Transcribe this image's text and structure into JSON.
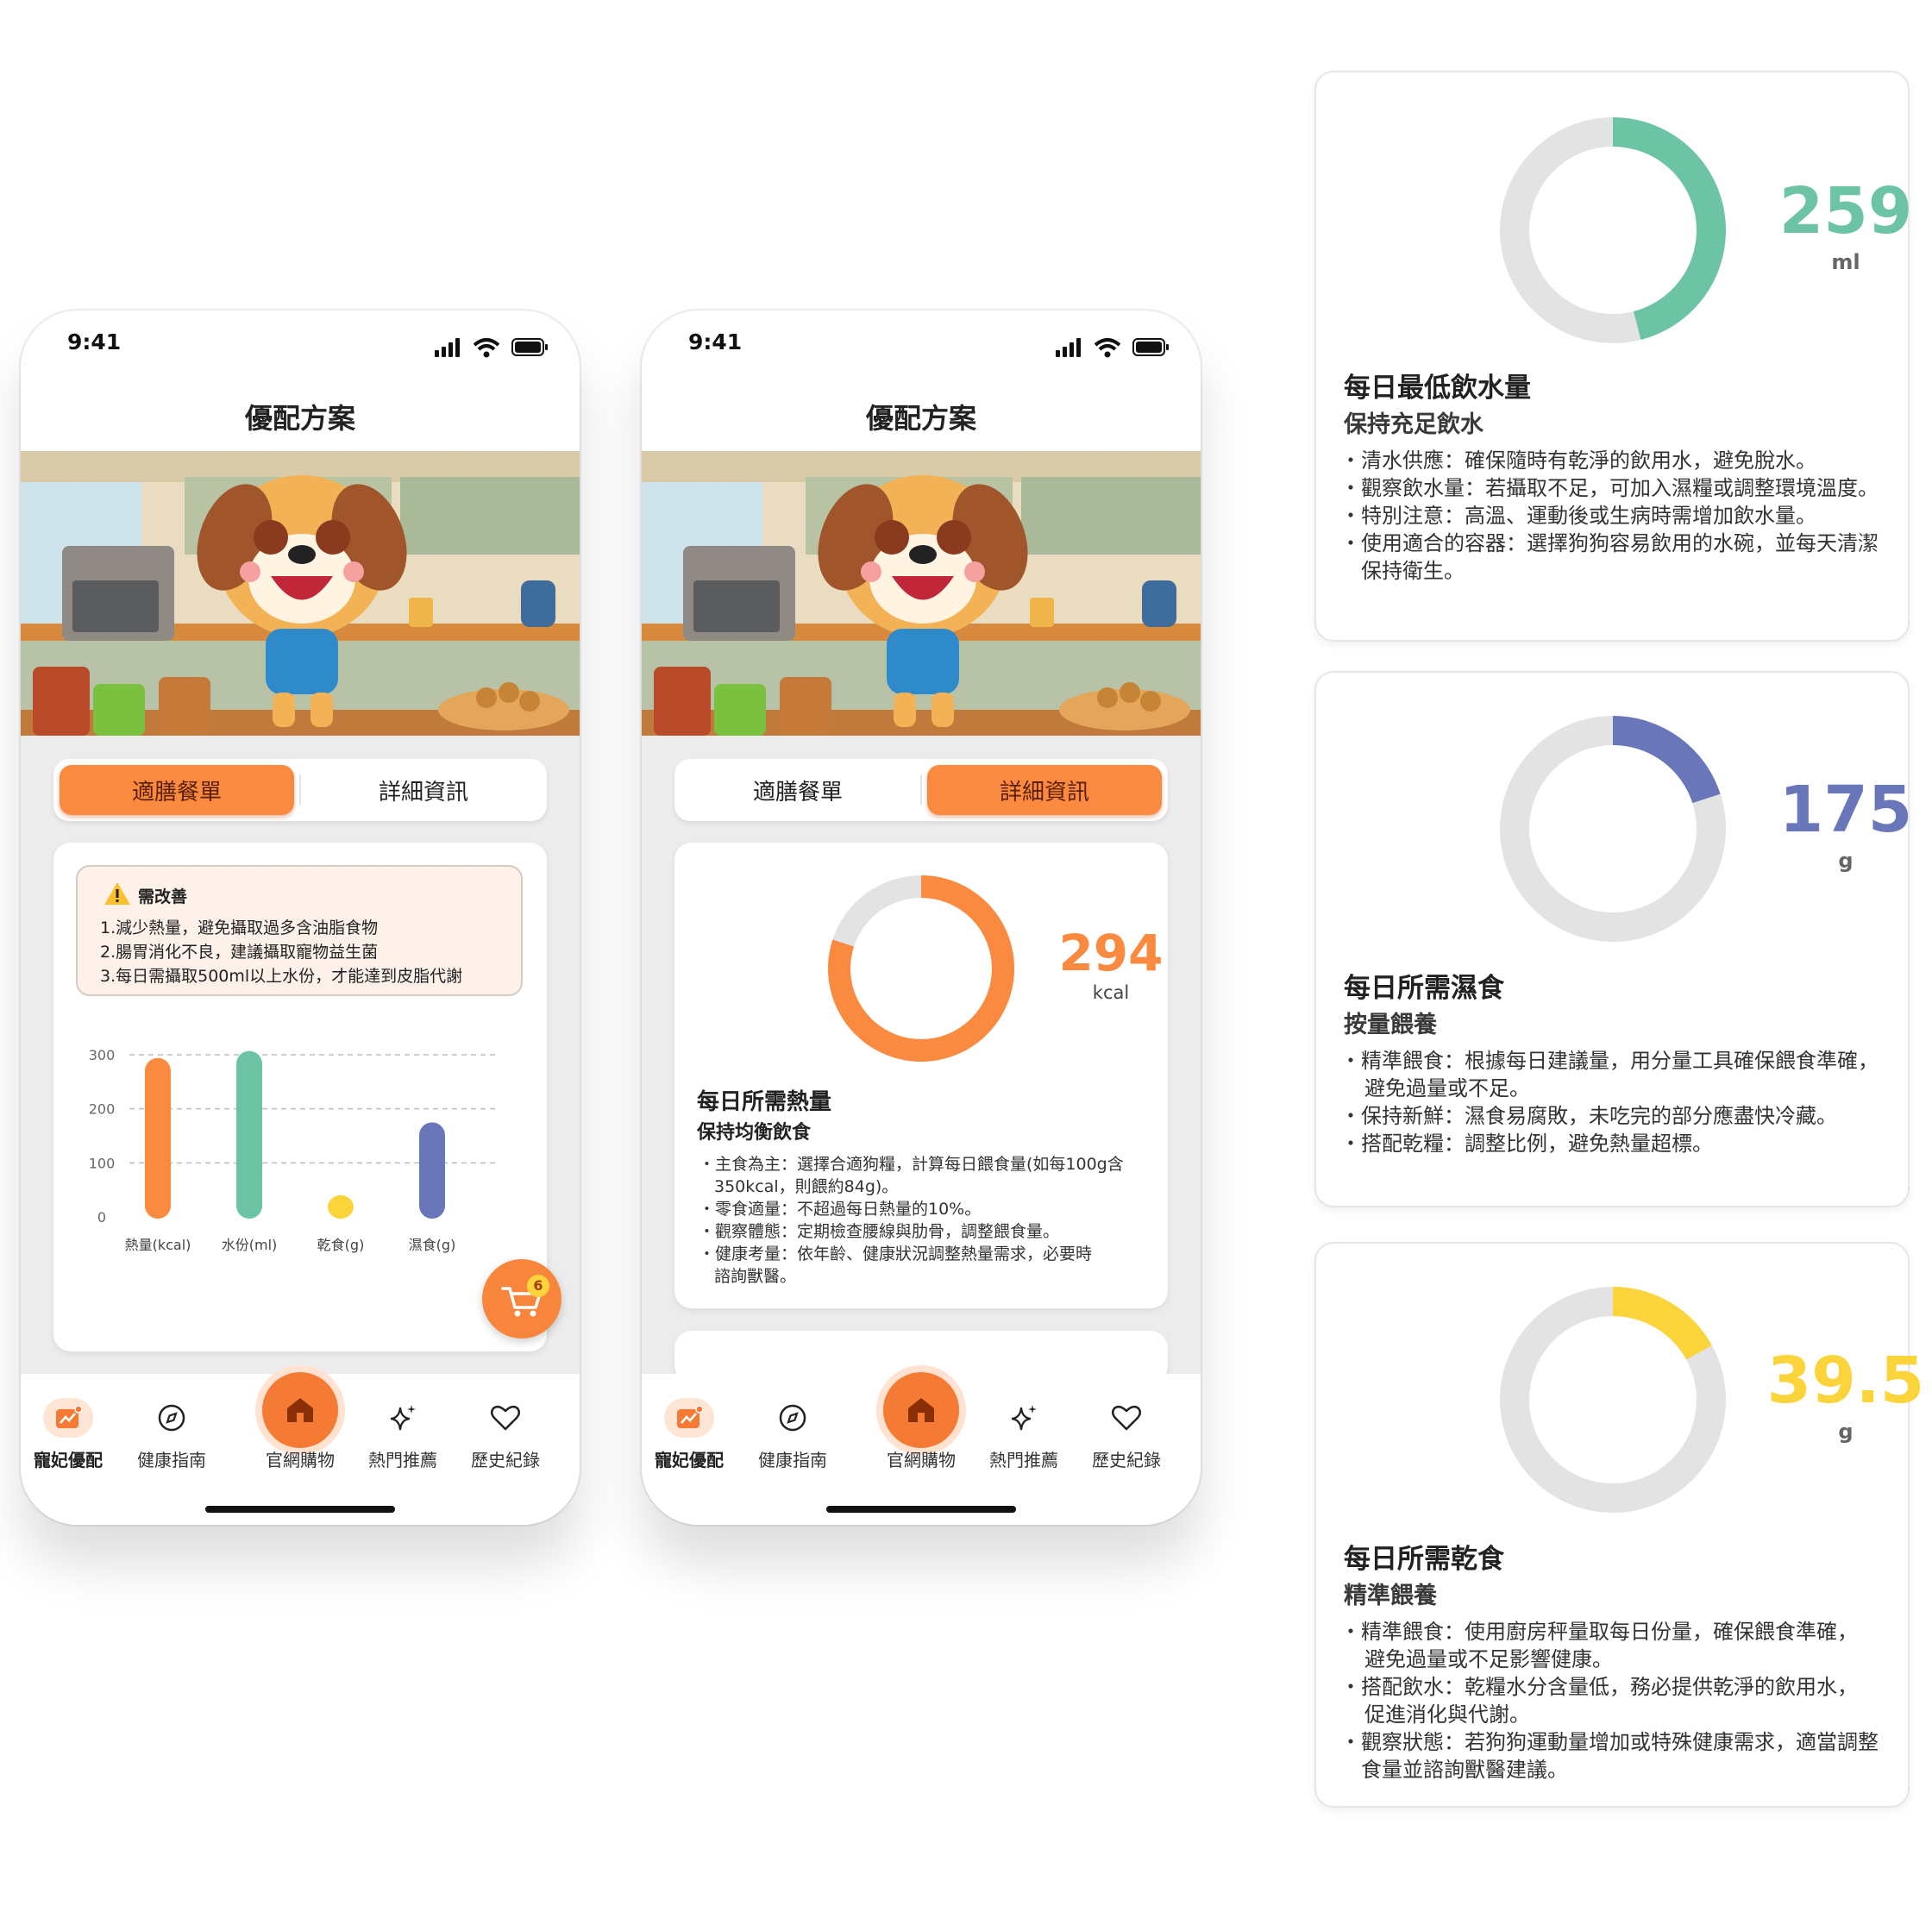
{
  "status": {
    "time": "9:41"
  },
  "app": {
    "title": "優配方案"
  },
  "tabs": {
    "menu": "適膳餐單",
    "details": "詳細資訊"
  },
  "warning": {
    "title": "需改善",
    "lines": [
      "1.減少熱量，避免攝取過多含油脂食物",
      "2.腸胃消化不良，建議攝取寵物益生菌",
      "3.每日需攝取500ml以上水份，才能達到皮脂代謝"
    ]
  },
  "chart_data": {
    "type": "bar",
    "categories": [
      "熱量(kcal)",
      "水份(ml)",
      "乾食(g)",
      "濕食(g)"
    ],
    "values": [
      294,
      307,
      40,
      175
    ],
    "colors": [
      "#fa8a3f",
      "#6cc4a4",
      "#fbd33a",
      "#6977ba"
    ],
    "ylim": [
      0,
      300
    ],
    "yticks": [
      "300",
      "200",
      "100",
      "0"
    ],
    "grid": "dashed"
  },
  "cart": {
    "count": "6"
  },
  "nav": {
    "items": [
      {
        "label": "寵妃優配",
        "icon": "chart-icon"
      },
      {
        "label": "健康指南",
        "icon": "compass-icon"
      },
      {
        "label": "官網購物",
        "icon": "home-icon"
      },
      {
        "label": "熱門推薦",
        "icon": "sparkle-icon"
      },
      {
        "label": "歷史紀錄",
        "icon": "heart-icon"
      }
    ]
  },
  "calories": {
    "value": "294",
    "unit": "kcal",
    "fraction": 0.8,
    "title": "每日所需熱量",
    "subtitle": "保持均衡飲食",
    "lines": [
      "・主食為主：選擇合適狗糧，計算每日餵食量(如每100g含",
      "350kcal，則餵約84g)。",
      "・零食適量：不超過每日熱量的10%。",
      "・觀察體態：定期檢查腰線與肋骨，調整餵食量。",
      "・健康考量：依年齡、健康狀況調整熱量需求，必要時",
      "諮詢獸醫。"
    ],
    "color": "#fa8a3f"
  },
  "water": {
    "value": "259",
    "unit": "ml",
    "fraction": 0.46,
    "title": "每日最低飲水量",
    "subtitle": "保持充足飲水",
    "lines": [
      "・清水供應：確保隨時有乾淨的飲用水，避免脫水。",
      "・觀察飲水量：若攝取不足，可加入濕糧或調整環境溫度。",
      "・特別注意：高溫、運動後或生病時需增加飲水量。",
      "・使用適合的容器：選擇狗狗容易飲用的水碗，並每天清潔",
      "保持衛生。"
    ],
    "color": "#6cc4a4"
  },
  "wetfood": {
    "value": "175",
    "unit": "g",
    "fraction": 0.2,
    "title": "每日所需濕食",
    "subtitle": "按量餵養",
    "lines": [
      "・精準餵食：根據每日建議量，用分量工具確保餵食準確，",
      "避免過量或不足。",
      "・保持新鮮：濕食易腐敗，未吃完的部分應盡快冷藏。",
      "・搭配乾糧：調整比例，避免熱量超標。"
    ],
    "color": "#6977ba"
  },
  "dryfood": {
    "value": "39.5",
    "unit": "g",
    "fraction": 0.17,
    "title": "每日所需乾食",
    "subtitle": "精準餵養",
    "lines": [
      "・精準餵食：使用廚房秤量取每日份量，確保餵食準確，",
      "避免過量或不足影響健康。",
      "・搭配飲水：乾糧水分含量低，務必提供乾淨的飲用水，",
      "促進消化與代謝。",
      "・觀察狀態：若狗狗運動量增加或特殊健康需求，適當調整",
      "食量並諮詢獸醫建議。"
    ],
    "color": "#fbd33a"
  }
}
